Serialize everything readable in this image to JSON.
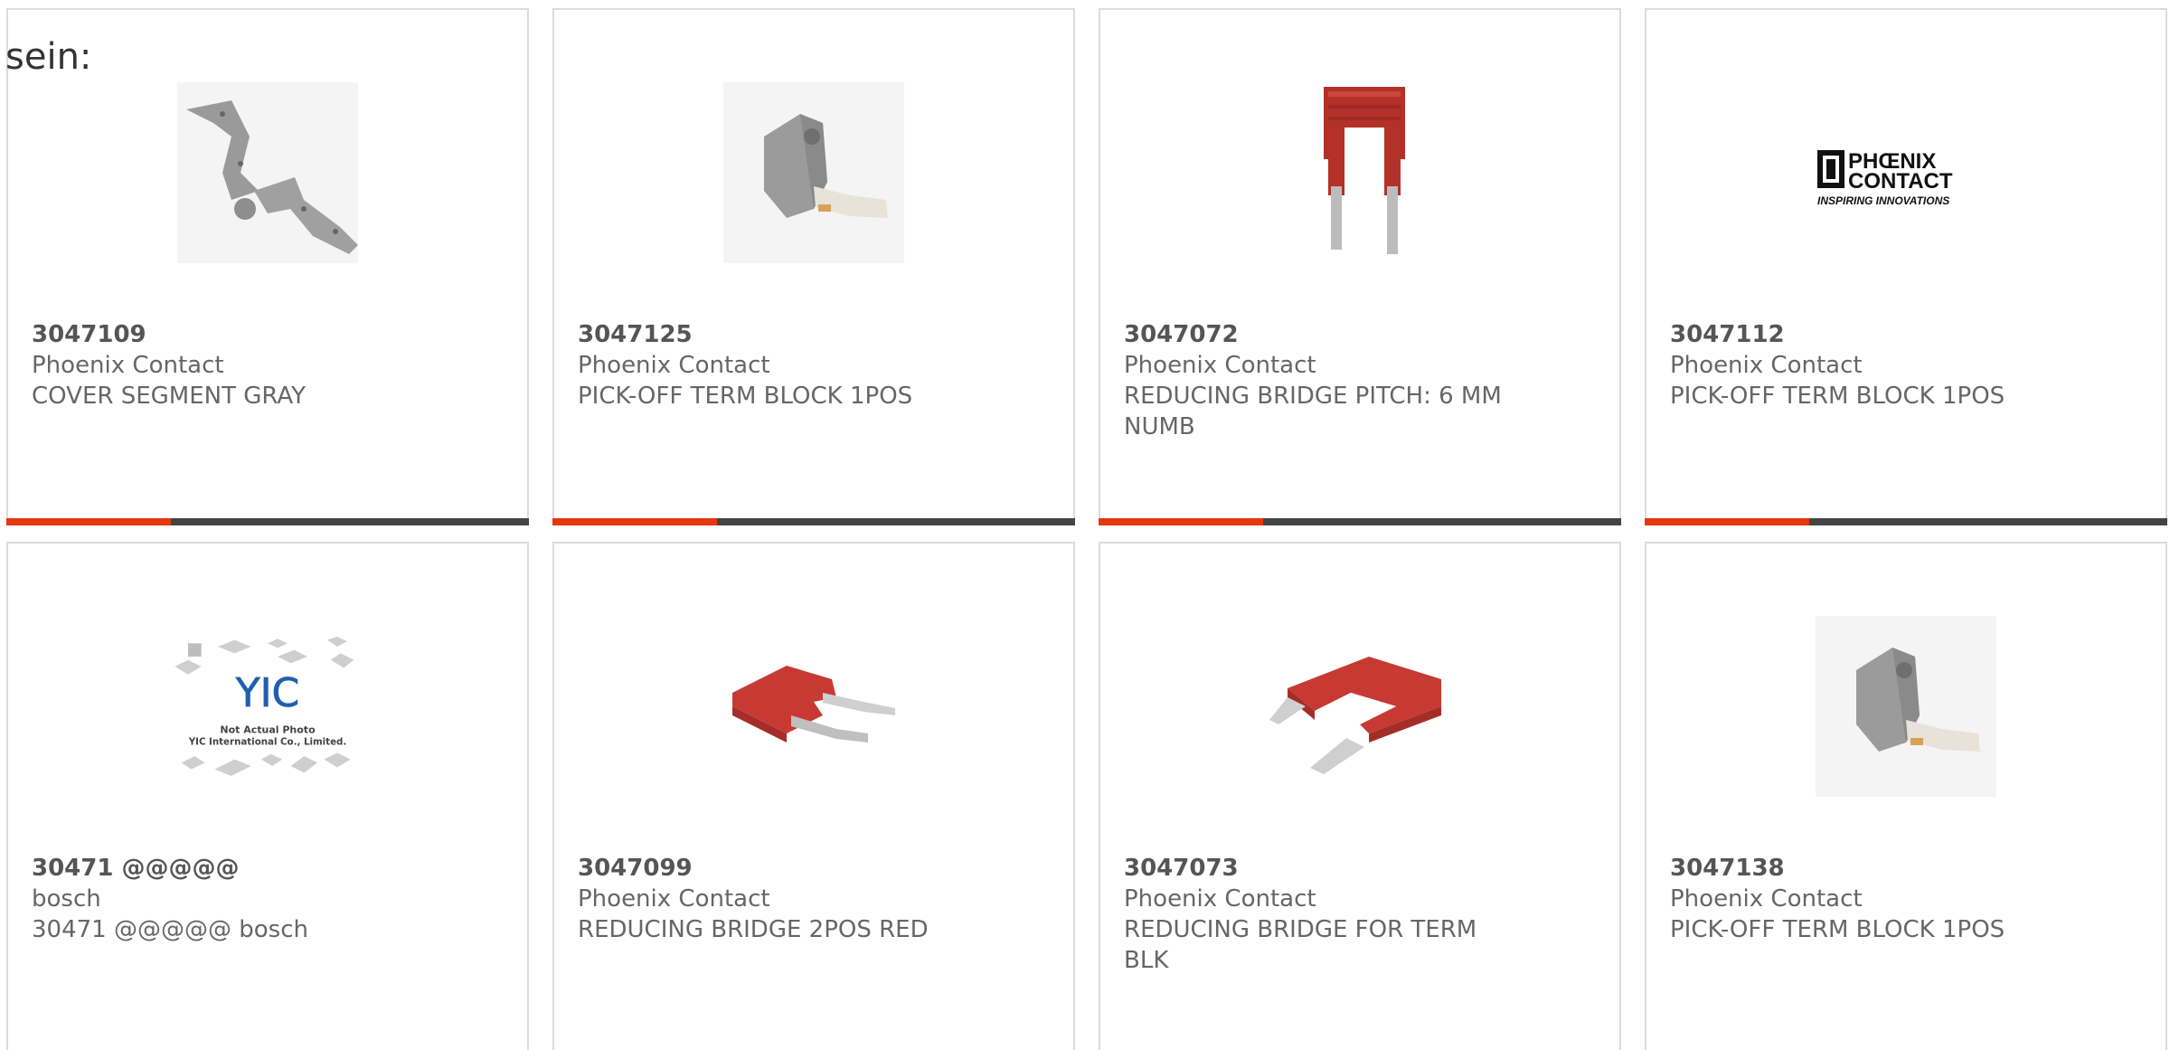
{
  "header_fragment": "sein:",
  "products": [
    {
      "part_number": "3047109",
      "manufacturer": "Phoenix Contact",
      "description": "COVER SEGMENT GRAY",
      "image_icon": "gray-cover-segment-image",
      "accent_color": "#e6370e"
    },
    {
      "part_number": "3047125",
      "manufacturer": "Phoenix Contact",
      "description": "PICK-OFF TERM BLOCK 1POS",
      "image_icon": "gray-pickoff-terminal-image",
      "accent_color": "#e6370e"
    },
    {
      "part_number": "3047072",
      "manufacturer": "Phoenix Contact",
      "description": "REDUCING BRIDGE PITCH: 6 MM NUMB",
      "image_icon": "red-bridge-vertical-image",
      "accent_color": "#e6370e"
    },
    {
      "part_number": "3047112",
      "manufacturer": "Phoenix Contact",
      "description": "PICK-OFF TERM BLOCK 1POS",
      "image_icon": "phoenix-contact-logo-image",
      "logo_line1": "PHŒNIX",
      "logo_line2": "CONTACT",
      "logo_tagline": "INSPIRING INNOVATIONS",
      "accent_color": "#e6370e"
    },
    {
      "part_number": "30471 @@@@@",
      "manufacturer": "bosch",
      "description": "30471 @@@@@ bosch",
      "image_icon": "not-actual-photo-placeholder-image",
      "placeholder_line1": "Not Actual Photo",
      "placeholder_line2": "YIC International Co., Limited.",
      "accent_color": "#e6370e"
    },
    {
      "part_number": "3047099",
      "manufacturer": "Phoenix Contact",
      "description": "REDUCING BRIDGE 2POS RED",
      "image_icon": "red-bridge-2pos-image",
      "accent_color": "#e6370e"
    },
    {
      "part_number": "3047073",
      "manufacturer": "Phoenix Contact",
      "description": "REDUCING BRIDGE FOR TERM BLK",
      "image_icon": "red-bridge-term-image",
      "accent_color": "#e6370e"
    },
    {
      "part_number": "3047138",
      "manufacturer": "Phoenix Contact",
      "description": "PICK-OFF TERM BLOCK 1POS",
      "image_icon": "gray-pickoff-terminal-image",
      "accent_color": "#e6370e"
    }
  ]
}
